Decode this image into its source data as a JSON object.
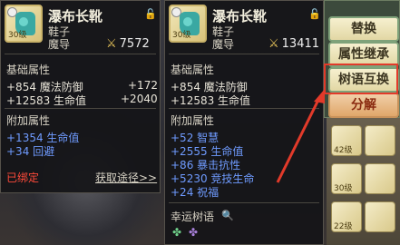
{
  "left_card": {
    "name": "瀑布长靴",
    "type": "鞋子",
    "job": "魔导",
    "level": "30级",
    "power": "7572",
    "base_title": "基础属性",
    "base": [
      {
        "text": "+854 魔法防御",
        "diff": "+172"
      },
      {
        "text": "+12583 生命值",
        "diff": "+2040"
      }
    ],
    "extra_title": "附加属性",
    "extra": [
      "+1354 生命值",
      "+34 回避"
    ],
    "bound": "已绑定",
    "source_link": "获取途径>>"
  },
  "right_card": {
    "name": "瀑布长靴",
    "type": "鞋子",
    "job": "魔导",
    "level": "30级",
    "power": "13411",
    "base_title": "基础属性",
    "base": [
      "+854 魔法防御",
      "+12583 生命值"
    ],
    "extra_title": "附加属性",
    "extra": [
      "+52 智慧",
      "+2555 生命值",
      "+86 暴击抗性",
      "+5230 竞技生命",
      "+24 祝福"
    ],
    "lucky_title": "幸运树语"
  },
  "buttons": {
    "replace": "替换",
    "inherit": "属性继承",
    "swap": "树语互换",
    "decompose": "分解"
  },
  "inventory": [
    "42级",
    "30级",
    "22级"
  ],
  "colors": {
    "accent_red": "#e23a2a",
    "extra_blue": "#6f9bff",
    "bound_red": "#ff4a3a",
    "sword_gold": "#e6c35a"
  }
}
